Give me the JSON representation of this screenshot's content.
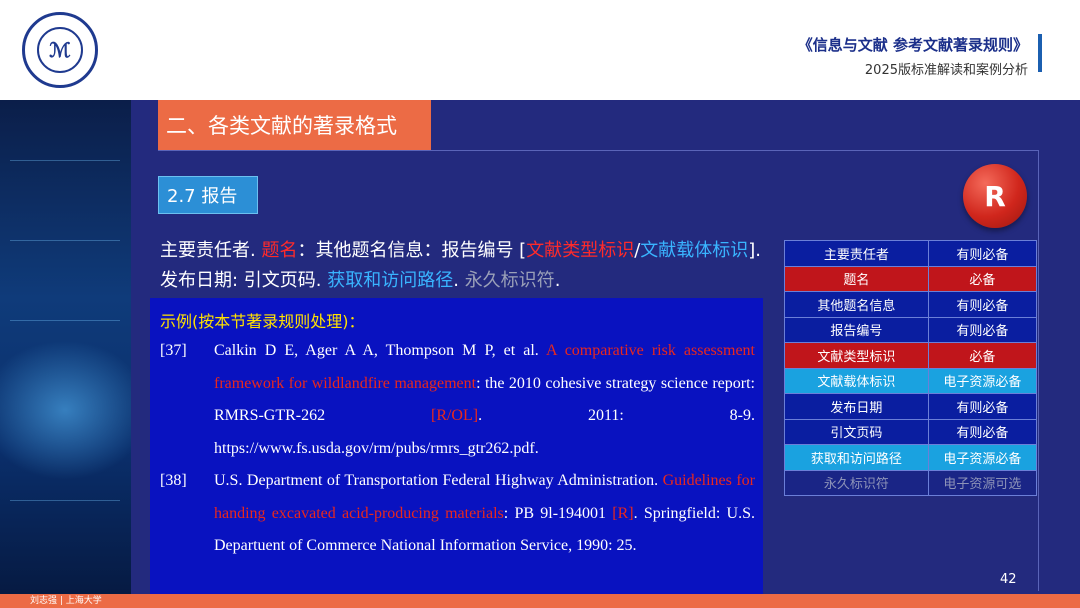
{
  "header": {
    "title": "《信息与文献  参考文献著录规则》",
    "subtitle": "2025版标准解读和案例分析"
  },
  "section_title": "二、各类文献的著录格式",
  "sub_title": "2.7 报告",
  "badge": "R",
  "format": {
    "p1": "主要责任者. ",
    "p2": "题名",
    "p3": "：其他题名信息：报告编号 [",
    "p4": "文献类型标识",
    "p5": "/",
    "p6": "文献载体标识",
    "p7": "]. 发布日期: 引文页码. ",
    "p8": "获取和访问路径",
    "p9": ". ",
    "p10": "永久标识符",
    "p11": "."
  },
  "example": {
    "heading": "示例(按本节著录规则处理)：",
    "refs": [
      {
        "num": "[37]",
        "a": "Calkin D E, Ager A A, Thompson M P, et al. ",
        "b": "A comparative risk assessment framework for wildlandfire management",
        "c": ": the 2010 cohesive strategy science report: RMRS-GTR-262 ",
        "d": "[R/OL]",
        "e": ". 2011: 8-9. ",
        "f": "https://www.fs.usda.gov/rm/pubs/rmrs_gtr262.pdf",
        "g": "."
      },
      {
        "num": "[38]",
        "a": "U.S. Department of Transportation Federal Highway Administration. ",
        "b": "Guidelines for handing excavated acid-producing materials",
        "c": ": PB 9l-194001 ",
        "d": "[R]",
        "e": ". Springfield: U.S. Departuent of Commerce National Information Service, 1990: 25."
      }
    ]
  },
  "table": [
    {
      "field": "主要责任者",
      "req": "有则必备",
      "style": "normal"
    },
    {
      "field": "题名",
      "req": "必备",
      "style": "red"
    },
    {
      "field": "其他题名信息",
      "req": "有则必备",
      "style": "normal"
    },
    {
      "field": "报告编号",
      "req": "有则必备",
      "style": "normal"
    },
    {
      "field": "文献类型标识",
      "req": "必备",
      "style": "red"
    },
    {
      "field": "文献载体标识",
      "req": "电子资源必备",
      "style": "cyan"
    },
    {
      "field": "发布日期",
      "req": "有则必备",
      "style": "normal"
    },
    {
      "field": "引文页码",
      "req": "有则必备",
      "style": "normal"
    },
    {
      "field": "获取和访问路径",
      "req": "电子资源必备",
      "style": "cyan"
    },
    {
      "field": "永久标识符",
      "req": "电子资源可选",
      "style": "dim"
    }
  ],
  "page_number": "42",
  "footer_text": "刘志强 | 上海大学",
  "colors": {
    "background": "#232a7e",
    "accent_orange": "#ec6b45",
    "highlight_red": "#ff2a2a",
    "highlight_blue": "#39b4ff",
    "example_bg": "#0912c0",
    "example_heading": "#ffe100"
  }
}
